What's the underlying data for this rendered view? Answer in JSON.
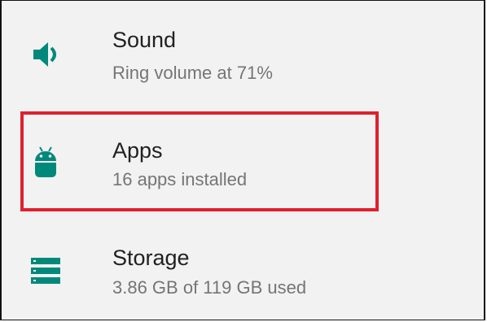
{
  "settings": {
    "items": [
      {
        "id": "sound",
        "title": "Sound",
        "summary": "Ring volume at 71%",
        "icon": "volume-icon"
      },
      {
        "id": "apps",
        "title": "Apps",
        "summary": "16 apps installed",
        "icon": "android-icon"
      },
      {
        "id": "storage",
        "title": "Storage",
        "summary": "3.86 GB of 119 GB used",
        "icon": "storage-icon"
      }
    ]
  },
  "colors": {
    "icon_accent": "#00897b",
    "title_text": "#212121",
    "summary_text": "#757575",
    "highlight_border": "#e0202e",
    "background": "#f2f2f2"
  }
}
